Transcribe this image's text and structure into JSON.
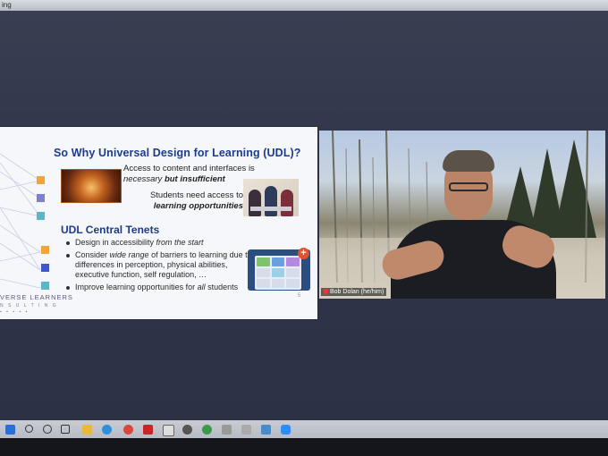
{
  "browser": {
    "tab_fragment": "ing"
  },
  "slide": {
    "title": "So Why Universal Design for Learning (UDL)?",
    "access_line1": "Access to content and interfaces is",
    "access_line2_normal": "necessary ",
    "access_line2_bold": "but insufficient",
    "students_line1": "Students need access to",
    "students_line2": "learning opportunities",
    "subheading": "UDL Central Tenets",
    "bullet1_normal": "Design in accessibility ",
    "bullet1_italic": "from the start",
    "bullet2_a": "Consider ",
    "bullet2_italic": "wide range",
    "bullet2_b": " of barriers to learning due to differences in perception, physical abilities, executive function, self regulation, …",
    "bullet3_normal": "Improve learning opportunities for ",
    "bullet3_italic": "all",
    "bullet3_tail": " students",
    "brand_line1": "VERSE LEARNERS",
    "brand_line2": "N S U L T I N G",
    "brand_dots": "▪ ▪ ▪ ▪ ▪",
    "plus_badge": "+",
    "slide_number": "5",
    "square_colors": [
      "#f2a33a",
      "#7b7fd6",
      "#5ab7c8",
      "#f2a33a",
      "#3f57c9",
      "#5ab7c8"
    ]
  },
  "video": {
    "participant_name": "Bob Dolan (he/him)"
  },
  "taskbar": {
    "icons": [
      "windows-icon",
      "search-icon",
      "cortana-icon",
      "task-view-icon",
      "file-explorer-icon",
      "edge-icon",
      "chrome-icon",
      "acrobat-icon",
      "word-icon",
      "settings-icon",
      "chrome-icon",
      "app-icon",
      "app-icon",
      "photos-icon",
      "zoom-icon"
    ]
  }
}
